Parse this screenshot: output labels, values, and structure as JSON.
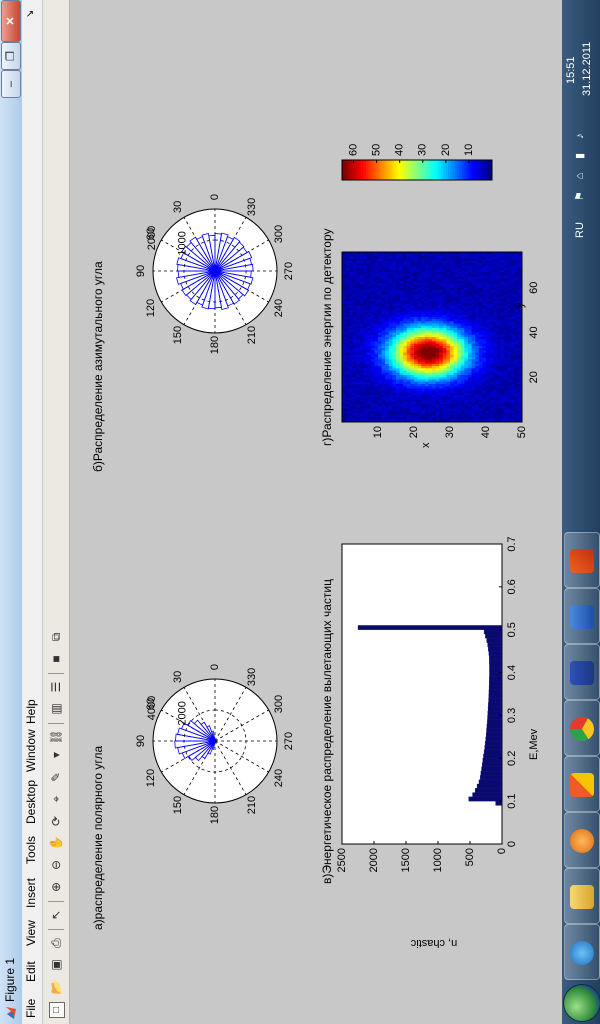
{
  "window": {
    "title": "Figure 1",
    "controls": {
      "minimize": "–",
      "maximize": "❐",
      "close": "✕"
    }
  },
  "menu": {
    "items": [
      "File",
      "Edit",
      "View",
      "Insert",
      "Tools",
      "Desktop",
      "Window",
      "Help"
    ],
    "arrow": "↘"
  },
  "toolbar": {
    "icons": [
      "new-figure-icon",
      "open-file-icon",
      "save-icon",
      "print-icon",
      "edit-plot-arrow-icon",
      "zoom-in-icon",
      "zoom-out-icon",
      "pan-hand-icon",
      "rotate-3d-icon",
      "data-cursor-icon",
      "brush-icon",
      "link-plot-icon",
      "insert-colorbar-icon",
      "insert-legend-icon",
      "hide-plot-tools-icon",
      "show-plot-tools-icon"
    ]
  },
  "panels": {
    "a": {
      "title": "а)распределение полярного угла",
      "radial_ticks": [
        "2000",
        "4000"
      ],
      "angle_labels": [
        "0",
        "30",
        "60",
        "90",
        "120",
        "150",
        "180",
        "210",
        "240",
        "270",
        "300",
        "330"
      ]
    },
    "b": {
      "title": "б)Распределение азимутального угла",
      "radial_ticks": [
        "1000",
        "2000"
      ],
      "angle_labels": [
        "0",
        "30",
        "60",
        "90",
        "120",
        "150",
        "180",
        "210",
        "240",
        "270",
        "300",
        "330"
      ]
    },
    "c": {
      "title": "в)Энергетическое распределение вылетающих частиц",
      "xlabel": "E,Mev",
      "ylabel": "n, chastic"
    },
    "d": {
      "title": "г)Распределение энергии по детектору",
      "xlabel": "y",
      "ylabel": "x"
    }
  },
  "chart_data": [
    {
      "type": "polar-rose",
      "title": "а)распределение полярного угла",
      "angle_ticks": [
        0,
        30,
        60,
        90,
        120,
        150,
        180,
        210,
        240,
        270,
        300,
        330
      ],
      "rlim": [
        0,
        4000
      ],
      "r_ticks": [
        2000,
        4000
      ],
      "bins_deg": [
        5,
        15,
        25,
        35,
        45,
        55,
        65,
        75,
        85,
        95,
        105,
        115,
        125,
        135,
        145,
        155,
        165,
        175
      ],
      "values": [
        200,
        650,
        1050,
        1400,
        1750,
        2050,
        2300,
        2450,
        2550,
        2600,
        2450,
        2250,
        1950,
        1650,
        1300,
        900,
        550,
        200
      ]
    },
    {
      "type": "polar-rose",
      "title": "б)Распределение азимутального угла",
      "angle_ticks": [
        0,
        30,
        60,
        90,
        120,
        150,
        180,
        210,
        240,
        270,
        300,
        330
      ],
      "rlim": [
        0,
        2000
      ],
      "r_ticks": [
        1000,
        2000
      ],
      "bins_deg": [
        5,
        15,
        25,
        35,
        45,
        55,
        65,
        75,
        85,
        95,
        105,
        115,
        125,
        135,
        145,
        155,
        165,
        175,
        185,
        195,
        205,
        215,
        225,
        235,
        245,
        255,
        265,
        275,
        285,
        295,
        305,
        315,
        325,
        335,
        345,
        355
      ],
      "values": [
        1150,
        1230,
        1180,
        1260,
        1200,
        1240,
        1170,
        1250,
        1210,
        1190,
        1260,
        1180,
        1230,
        1200,
        1250,
        1170,
        1240,
        1220,
        1190,
        1260,
        1200,
        1230,
        1180,
        1250,
        1210,
        1240,
        1170,
        1230,
        1200,
        1260,
        1190,
        1220,
        1250,
        1180,
        1240,
        1210
      ]
    },
    {
      "type": "bar",
      "title": "в)Энергетическое распределение вылетающих частиц",
      "xlabel": "E,Mev",
      "ylabel": "n, chastic",
      "xlim": [
        0,
        0.7
      ],
      "ylim": [
        0,
        2500
      ],
      "x_ticks": [
        0,
        0.1,
        0.2,
        0.3,
        0.4,
        0.5,
        0.6,
        0.7
      ],
      "y_ticks": [
        0,
        500,
        1000,
        1500,
        2000,
        2500
      ],
      "bar_color": "#0a0a6e",
      "x": [
        0.095,
        0.105,
        0.115,
        0.125,
        0.135,
        0.145,
        0.155,
        0.165,
        0.175,
        0.185,
        0.195,
        0.205,
        0.215,
        0.225,
        0.235,
        0.245,
        0.255,
        0.265,
        0.275,
        0.285,
        0.295,
        0.305,
        0.315,
        0.325,
        0.335,
        0.345,
        0.355,
        0.365,
        0.375,
        0.385,
        0.395,
        0.405,
        0.415,
        0.425,
        0.435,
        0.445,
        0.455,
        0.465,
        0.475,
        0.485,
        0.495,
        0.505
      ],
      "values": [
        100,
        520,
        460,
        420,
        390,
        360,
        340,
        330,
        320,
        310,
        300,
        290,
        280,
        270,
        262,
        255,
        248,
        242,
        236,
        230,
        226,
        222,
        218,
        214,
        210,
        206,
        204,
        202,
        200,
        198,
        196,
        196,
        196,
        198,
        200,
        205,
        215,
        225,
        240,
        260,
        280,
        2250
      ]
    },
    {
      "type": "heatmap",
      "title": "г)Распределение энергии по детектору",
      "xlabel": "y",
      "ylabel": "x",
      "x_ticks": [
        20,
        40,
        60
      ],
      "y_ticks": [
        10,
        20,
        30,
        40,
        50
      ],
      "colorbar_ticks": [
        10,
        20,
        30,
        40,
        50,
        60
      ],
      "clim": [
        0,
        65
      ],
      "colormap": "jet",
      "peak_x": 24,
      "peak_y": 31,
      "peak_value": 65
    }
  ],
  "taskbar": {
    "apps": [
      "internet-explorer-icon",
      "file-explorer-icon",
      "media-player-icon",
      "office-icon",
      "chrome-icon",
      "floppy-save-icon",
      "word-icon",
      "matlab-icon"
    ]
  },
  "tray": {
    "language": "RU",
    "time": "15:51",
    "date": "31.12.2011"
  },
  "colors": {
    "blue_data": "#0000ff",
    "bar": "#0a0a6e",
    "taskbar": "#2b4a6b"
  }
}
